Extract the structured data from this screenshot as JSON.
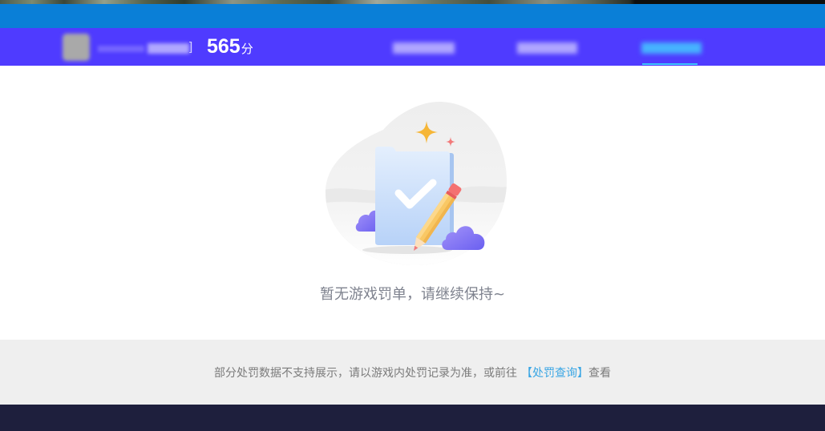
{
  "colors": {
    "top_bar": "#0a7fd7",
    "header_bg": "#4f3bff",
    "active_tab": "#3cc6fb",
    "message_text": "#7e828e",
    "notice_bg": "#efefef",
    "notice_text": "#7b7b7b",
    "link": "#3aa6e4",
    "footer_bg": "#1e1f3d"
  },
  "header": {
    "avatar_icon": "avatar-icon",
    "name_suffix": "]",
    "score": {
      "value": "565",
      "unit": "分"
    },
    "tabs": [
      {
        "active": false
      },
      {
        "active": false
      },
      {
        "active": true
      }
    ]
  },
  "empty_state": {
    "illustration": "empty-document-check-icon",
    "message": "暂无游戏罚单，请继续保持~"
  },
  "notice": {
    "text": "部分处罚数据不支持展示，请以游戏内处罚记录为准，或前往",
    "link_label": "【处罚查询】",
    "suffix": "查看"
  }
}
